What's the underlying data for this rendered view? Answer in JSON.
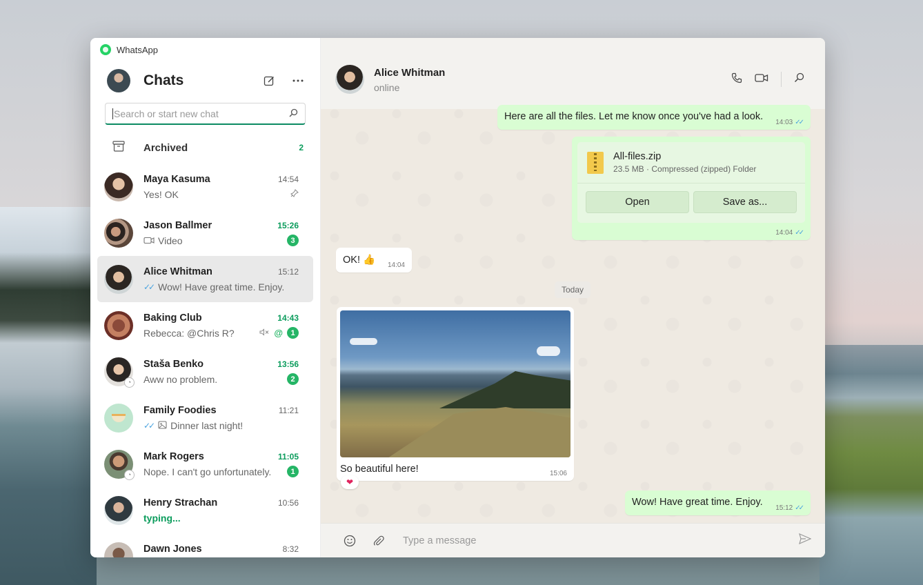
{
  "app": {
    "title": "WhatsApp"
  },
  "sidebar": {
    "title": "Chats",
    "search_placeholder": "Search or start new chat",
    "archived": {
      "label": "Archived",
      "count": "2"
    },
    "chats": [
      {
        "name": "Maya Kasuma",
        "time": "14:54",
        "preview": "Yes! OK",
        "pinned": true
      },
      {
        "name": "Jason Ballmer",
        "time": "15:26",
        "preview": "Video",
        "unread": "3"
      },
      {
        "name": "Alice Whitman",
        "time": "15:12",
        "preview": "Wow! Have great time. Enjoy.",
        "selected": true
      },
      {
        "name": "Baking Club",
        "time": "14:43",
        "preview": "Rebecca: @Chris R?",
        "mention": "@",
        "unread": "1"
      },
      {
        "name": "Staša Benko",
        "time": "13:56",
        "preview": "Aww no problem.",
        "unread": "2"
      },
      {
        "name": "Family Foodies",
        "time": "11:21",
        "preview": "Dinner last night!"
      },
      {
        "name": "Mark Rogers",
        "time": "11:05",
        "preview": "Nope. I can't go unfortunately.",
        "unread": "1"
      },
      {
        "name": "Henry Strachan",
        "time": "10:56",
        "preview": "typing..."
      },
      {
        "name": "Dawn Jones",
        "time": "8:32",
        "preview": ""
      }
    ]
  },
  "conversation": {
    "contact_name": "Alice Whitman",
    "contact_status": "online",
    "messages": {
      "m1": {
        "text": "Here are all the files. Let me know once you've had a look.",
        "time": "14:03"
      },
      "m2": {
        "file_name": "All-files.zip",
        "file_meta": "23.5 MB · Compressed (zipped) Folder",
        "open_label": "Open",
        "save_label": "Save as...",
        "time": "14:04"
      },
      "m3": {
        "text": "OK! 👍",
        "time": "14:04"
      },
      "day": "Today",
      "m4": {
        "caption": "So beautiful here!",
        "time": "15:06",
        "reaction": "❤"
      },
      "m5": {
        "text": "Wow! Have great time. Enjoy.",
        "time": "15:12"
      }
    },
    "composer_placeholder": "Type a message"
  },
  "colors": {
    "accent": "#25b566",
    "outgoing_bubble": "#d9fdd3",
    "read_ticks": "#4aa3df"
  }
}
